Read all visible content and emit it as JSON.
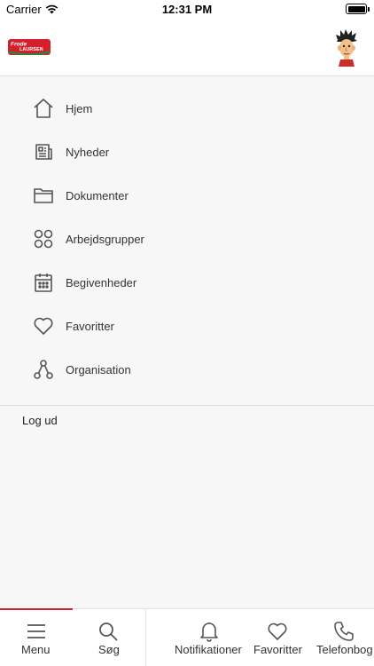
{
  "status_bar": {
    "carrier": "Carrier",
    "time": "12:31 PM"
  },
  "header": {
    "logo_top": "Frode",
    "logo_bottom": "LAURSEN"
  },
  "menu": {
    "items": [
      {
        "label": "Hjem",
        "icon": "home-icon"
      },
      {
        "label": "Nyheder",
        "icon": "newspaper-icon"
      },
      {
        "label": "Dokumenter",
        "icon": "folder-icon"
      },
      {
        "label": "Arbejdsgrupper",
        "icon": "groups-icon"
      },
      {
        "label": "Begivenheder",
        "icon": "calendar-icon"
      },
      {
        "label": "Favoritter",
        "icon": "heart-icon"
      },
      {
        "label": "Organisation",
        "icon": "organisation-icon"
      }
    ],
    "logout": "Log ud"
  },
  "tab_bar": {
    "tabs": [
      {
        "label": "Menu",
        "icon": "menu-icon",
        "active": true
      },
      {
        "label": "Søg",
        "icon": "search-icon"
      },
      {
        "label": "Notifikationer",
        "icon": "bell-icon"
      },
      {
        "label": "Favoritter",
        "icon": "heart-icon"
      },
      {
        "label": "Telefonbog",
        "icon": "phone-icon"
      }
    ]
  },
  "colors": {
    "accent": "#d4202c",
    "icon": "#555555",
    "background": "#f7f7f7"
  }
}
